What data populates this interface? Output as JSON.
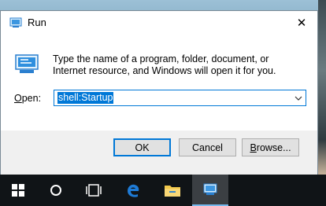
{
  "dialog": {
    "title": "Run",
    "close_glyph": "✕",
    "description": "Type the name of a program, folder, document, or Internet resource, and Windows will open it for you.",
    "open_label_prefix": "O",
    "open_label_rest": "pen:",
    "open_value": "shell:Startup",
    "buttons": {
      "ok": "OK",
      "cancel": "Cancel",
      "browse_prefix": "B",
      "browse_rest": "rowse..."
    }
  },
  "taskbar": {
    "items": [
      {
        "icon": "windows-start-icon"
      },
      {
        "icon": "cortana-search-icon"
      },
      {
        "icon": "task-view-icon"
      },
      {
        "icon": "edge-browser-icon"
      },
      {
        "icon": "file-explorer-icon"
      },
      {
        "icon": "run-app-icon",
        "active": true
      }
    ]
  },
  "colors": {
    "accent": "#0078d7",
    "taskbar": "#101417",
    "edge_blue": "#1e7bd6",
    "folder_yellow": "#f2c94c"
  }
}
